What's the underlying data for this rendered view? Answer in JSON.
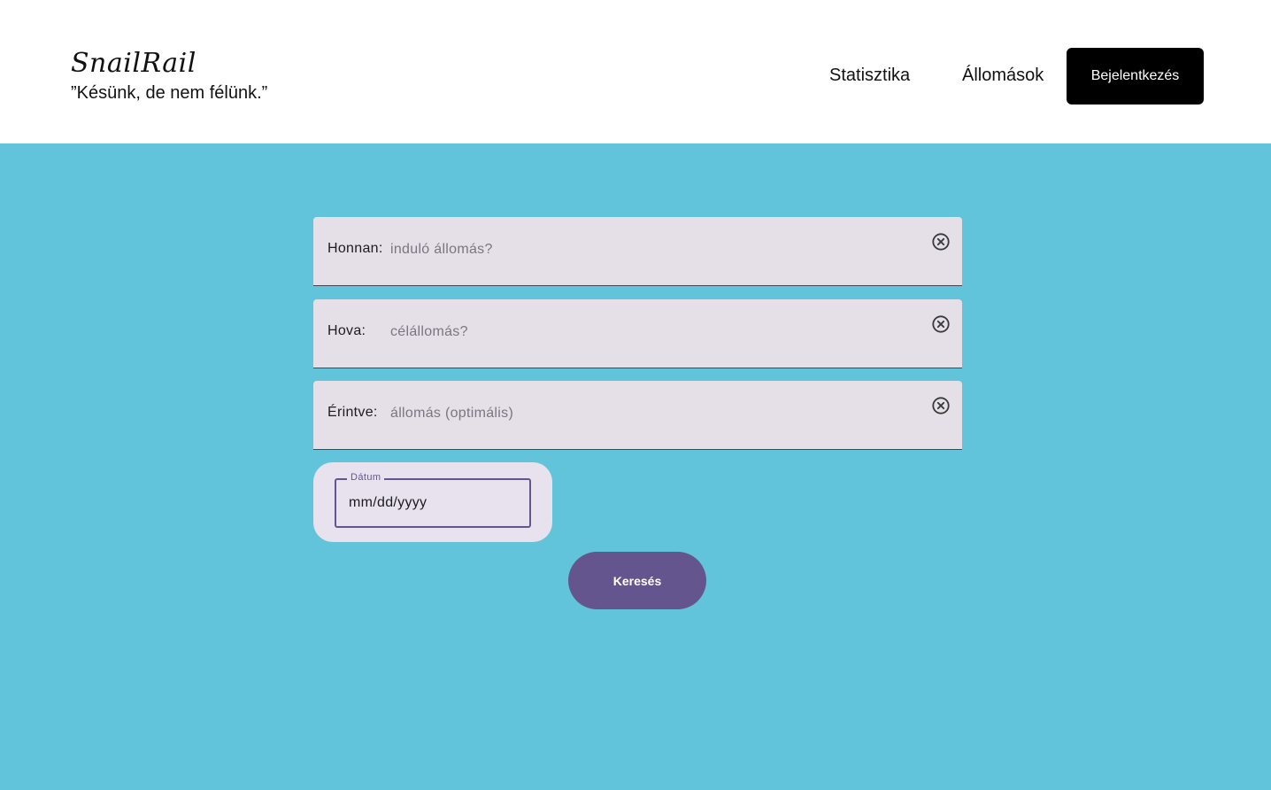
{
  "header": {
    "logo": "SnailRail",
    "tagline": "”Késünk, de nem félünk.”",
    "nav": {
      "statistics": "Statisztika",
      "stations": "Állomások"
    },
    "login_label": "Bejelentkezés"
  },
  "form": {
    "from": {
      "label": "Honnan:",
      "placeholder": "induló állomás?",
      "value": ""
    },
    "to": {
      "label": "Hova:",
      "placeholder": "célállomás?",
      "value": ""
    },
    "via": {
      "label": "Érintve:",
      "placeholder": "állomás (optimális)",
      "value": ""
    },
    "date": {
      "label": "Dátum",
      "placeholder": "mm/dd/yyyy",
      "value": ""
    },
    "search_label": "Keresés"
  },
  "icons": {
    "clear": "close-circle-icon"
  },
  "colors": {
    "background": "#62c4da",
    "header": "#ffffff",
    "field": "#e5e0e8",
    "accent": "#65558f",
    "login_button": "#000000"
  }
}
